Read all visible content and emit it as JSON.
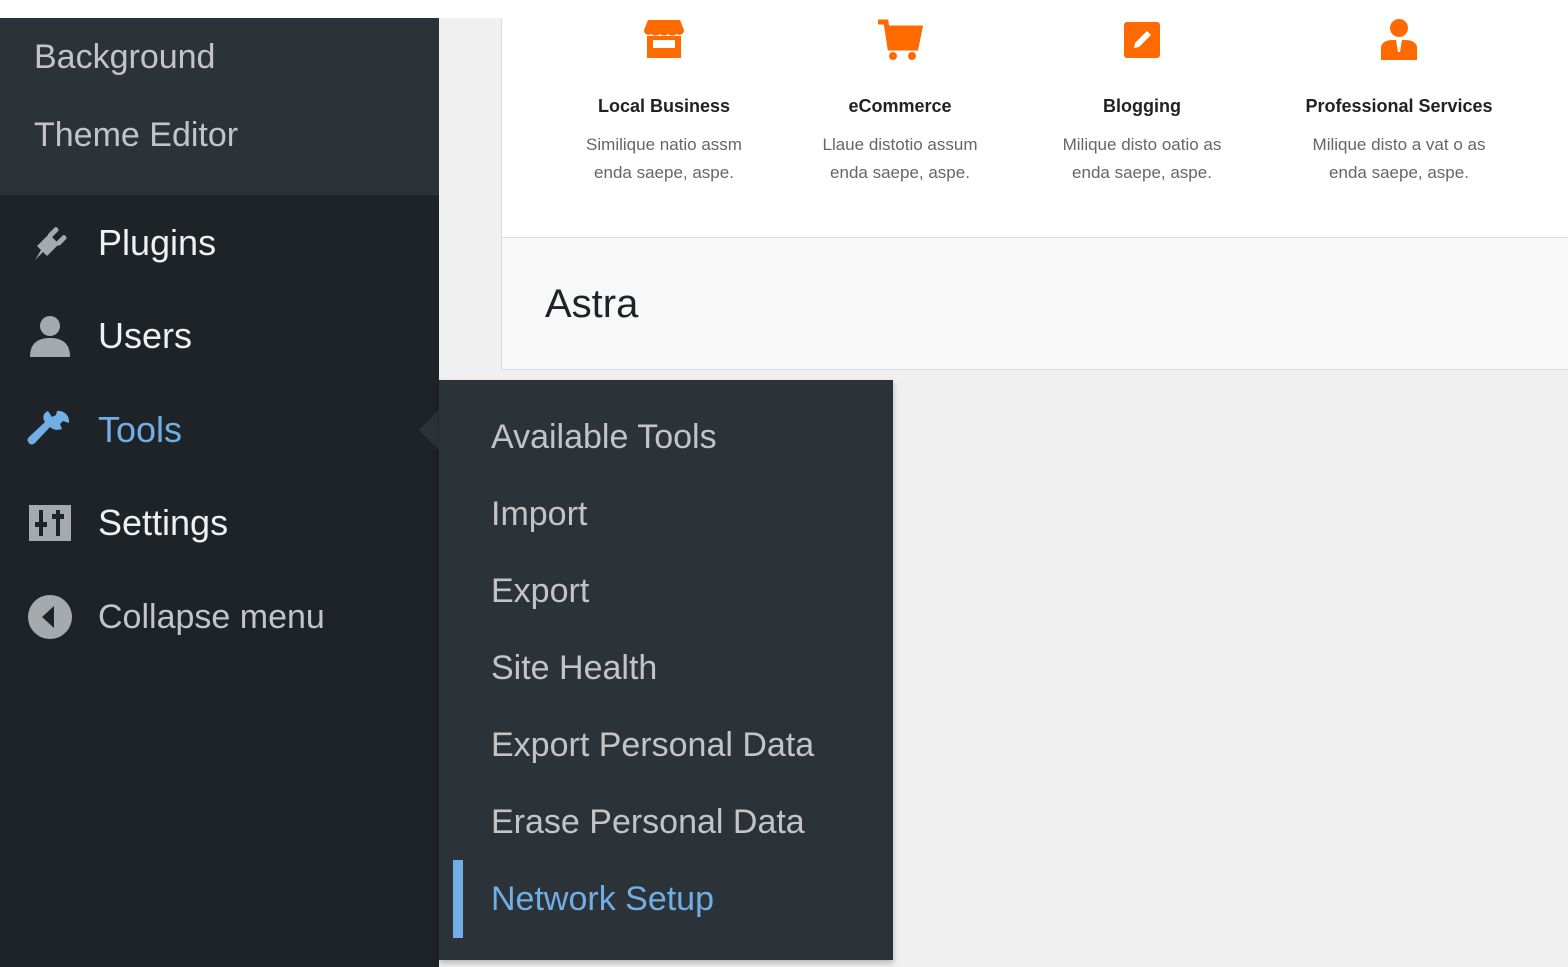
{
  "sidebar": {
    "submenu": [
      "Background",
      "Theme Editor"
    ],
    "items": [
      {
        "label": "Plugins",
        "icon": "plugins-icon"
      },
      {
        "label": "Users",
        "icon": "users-icon"
      },
      {
        "label": "Tools",
        "icon": "tools-icon",
        "active": true
      },
      {
        "label": "Settings",
        "icon": "settings-icon"
      },
      {
        "label": "Collapse menu",
        "icon": "collapse-icon"
      }
    ]
  },
  "flyout": {
    "items": [
      "Available Tools",
      "Import",
      "Export",
      "Site Health",
      "Export Personal Data",
      "Erase Personal Data",
      "Network Setup"
    ],
    "current": "Network Setup"
  },
  "features": [
    {
      "title": "Local Business",
      "desc_1": "Similique natio assm",
      "desc_2": "enda saepe, aspe.",
      "icon": "store-icon"
    },
    {
      "title": "eCommerce",
      "desc_1": "Llaue distotio assum",
      "desc_2": "enda saepe, aspe.",
      "icon": "cart-icon"
    },
    {
      "title": "Blogging",
      "desc_1": "Milique disto oatio as",
      "desc_2": "enda saepe, aspe.",
      "icon": "edit-icon"
    },
    {
      "title": "Professional Services",
      "desc_1": "Milique disto a vat o as",
      "desc_2": "enda saepe, aspe.",
      "icon": "businessman-icon"
    }
  ],
  "panel": {
    "title": "Astra"
  },
  "colors": {
    "accent": "#72aee6",
    "orange": "#ff6a00",
    "sidebar": "#1d2327",
    "submenu": "#2c3338"
  }
}
